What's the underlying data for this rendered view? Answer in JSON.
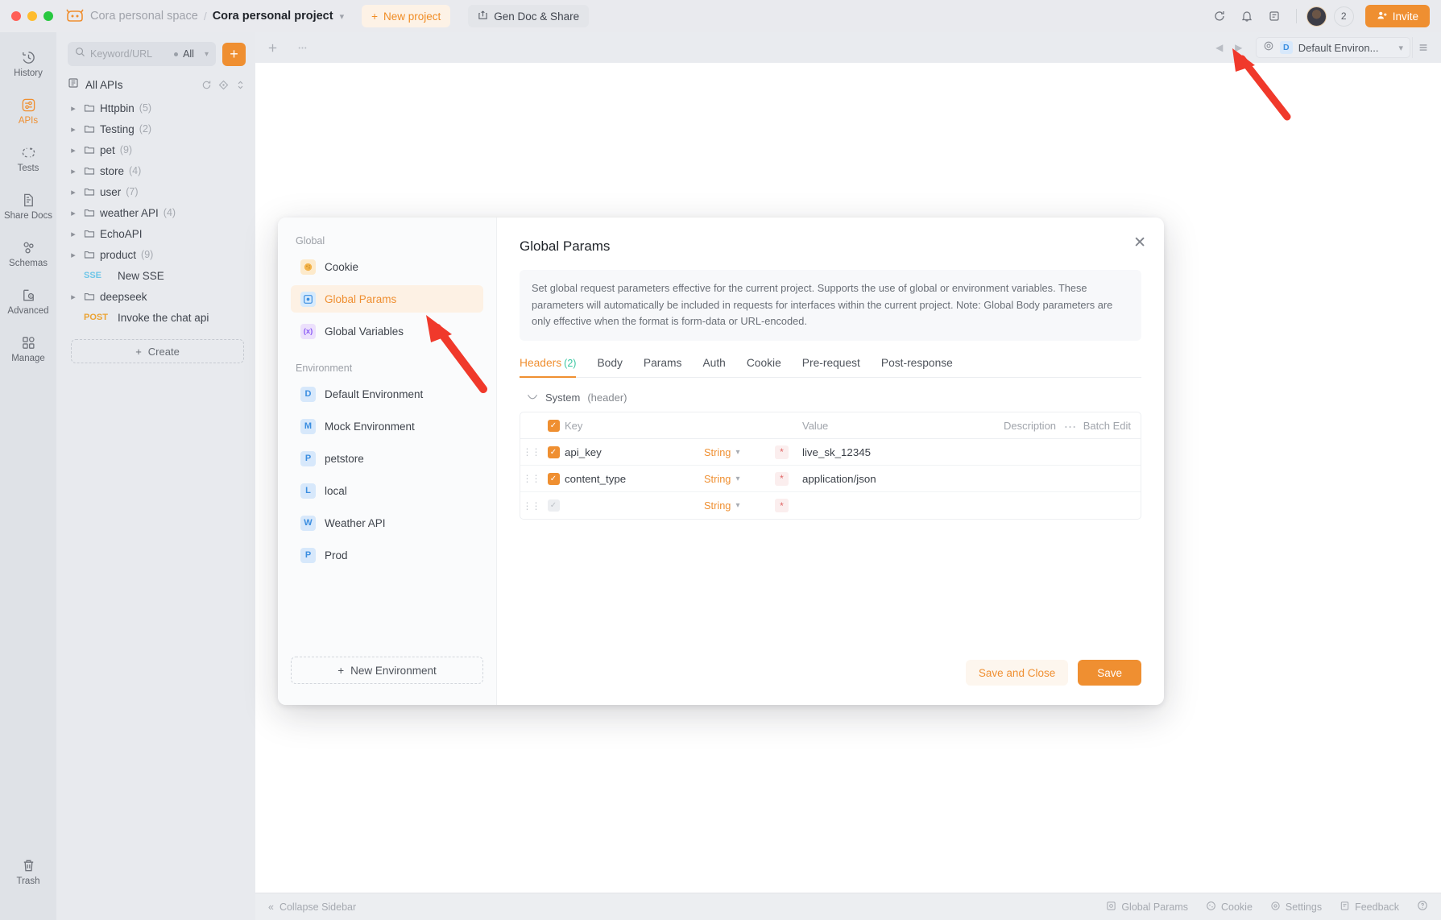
{
  "titlebar": {
    "breadcrumb_space": "Cora personal space",
    "breadcrumb_sep": "/",
    "breadcrumb_project": "Cora personal project",
    "new_project_label": "New project",
    "gen_doc_label": "Gen Doc & Share",
    "member_count": "2",
    "invite_label": "Invite"
  },
  "rail": {
    "items": [
      {
        "label": "History",
        "icon": "history-icon",
        "active": false
      },
      {
        "label": "APIs",
        "icon": "apis-icon",
        "active": true
      },
      {
        "label": "Tests",
        "icon": "tests-icon",
        "active": false
      },
      {
        "label": "Share Docs",
        "icon": "share-docs-icon",
        "active": false
      },
      {
        "label": "Schemas",
        "icon": "schemas-icon",
        "active": false
      },
      {
        "label": "Advanced",
        "icon": "advanced-icon",
        "active": false
      },
      {
        "label": "Manage",
        "icon": "manage-icon",
        "active": false
      }
    ],
    "trash_label": "Trash"
  },
  "sidebar": {
    "search_placeholder": "Keyword/URL",
    "filter_label": "All",
    "add_button": "+",
    "all_apis_label": "All APIs",
    "create_label": "Create",
    "tree": [
      {
        "type": "folder",
        "label": "Httpbin",
        "count": "(5)"
      },
      {
        "type": "folder",
        "label": "Testing",
        "count": "(2)"
      },
      {
        "type": "folder",
        "label": "pet",
        "count": "(9)"
      },
      {
        "type": "folder",
        "label": "store",
        "count": "(4)"
      },
      {
        "type": "folder",
        "label": "user",
        "count": "(7)"
      },
      {
        "type": "folder",
        "label": "weather API",
        "count": "(4)"
      },
      {
        "type": "folder",
        "label": "EchoAPI",
        "count": ""
      },
      {
        "type": "folder",
        "label": "product",
        "count": "(9)"
      },
      {
        "type": "api",
        "method": "SSE",
        "method_class": "sse",
        "label": "New SSE"
      },
      {
        "type": "folder",
        "label": "deepseek",
        "count": ""
      },
      {
        "type": "api",
        "method": "POST",
        "method_class": "post",
        "label": "Invoke the chat api"
      }
    ]
  },
  "main": {
    "env_selector": {
      "badge": "D",
      "name": "Default Environ..."
    }
  },
  "statusbar": {
    "collapse_label": "Collapse Sidebar",
    "items": [
      {
        "label": "Global Params",
        "icon": "global-params-icon"
      },
      {
        "label": "Cookie",
        "icon": "cookie-icon"
      },
      {
        "label": "Settings",
        "icon": "settings-icon"
      },
      {
        "label": "Feedback",
        "icon": "feedback-icon"
      }
    ]
  },
  "modal": {
    "title": "Global Params",
    "description": "Set global request parameters effective for the current project. Supports the use of global or environment variables. These parameters will automatically be included in requests for interfaces within the current project. Note: Global Body parameters are only effective when the format is form-data or URL-encoded.",
    "nav": {
      "global_group": "Global",
      "environment_group": "Environment",
      "global_items": [
        {
          "label": "Cookie",
          "icon": "cookie-icon",
          "badge": "",
          "active": false
        },
        {
          "label": "Global Params",
          "icon": "global-params-icon",
          "badge": "",
          "active": true
        },
        {
          "label": "Global Variables",
          "icon": "global-variables-icon",
          "badge": "(x)",
          "active": false
        }
      ],
      "environments": [
        {
          "label": "Default Environment",
          "badge": "D"
        },
        {
          "label": "Mock Environment",
          "badge": "M"
        },
        {
          "label": "petstore",
          "badge": "P"
        },
        {
          "label": "local",
          "badge": "L"
        },
        {
          "label": "Weather API",
          "badge": "W"
        },
        {
          "label": "Prod",
          "badge": "P"
        }
      ],
      "new_environment_label": "New Environment"
    },
    "tabs": [
      {
        "label": "Headers",
        "count": "(2)",
        "active": true
      },
      {
        "label": "Body",
        "count": "",
        "active": false
      },
      {
        "label": "Params",
        "count": "",
        "active": false
      },
      {
        "label": "Auth",
        "count": "",
        "active": false
      },
      {
        "label": "Cookie",
        "count": "",
        "active": false
      },
      {
        "label": "Pre-request",
        "count": "",
        "active": false
      },
      {
        "label": "Post-response",
        "count": "",
        "active": false
      }
    ],
    "system_row": {
      "label": "System",
      "sub": "(header)"
    },
    "table": {
      "headers": {
        "key": "Key",
        "value": "Value",
        "description": "Description",
        "batch_edit": "Batch Edit"
      },
      "rows": [
        {
          "checked": true,
          "key": "api_key",
          "type": "String",
          "required": "*",
          "value": "live_sk_12345",
          "description": ""
        },
        {
          "checked": true,
          "key": "content_type",
          "type": "String",
          "required": "*",
          "value": "application/json",
          "description": ""
        },
        {
          "checked": false,
          "key": "",
          "type": "String",
          "required": "*",
          "value": "",
          "description": ""
        }
      ]
    },
    "buttons": {
      "save_and_close": "Save and Close",
      "save": "Save"
    }
  },
  "colors": {
    "accent": "#ef8f31",
    "accent_soft": "#fdf1e4",
    "badge_blue": "#3b8ee0",
    "count_green": "#38c6a0",
    "arrow_red": "#f0392b"
  }
}
